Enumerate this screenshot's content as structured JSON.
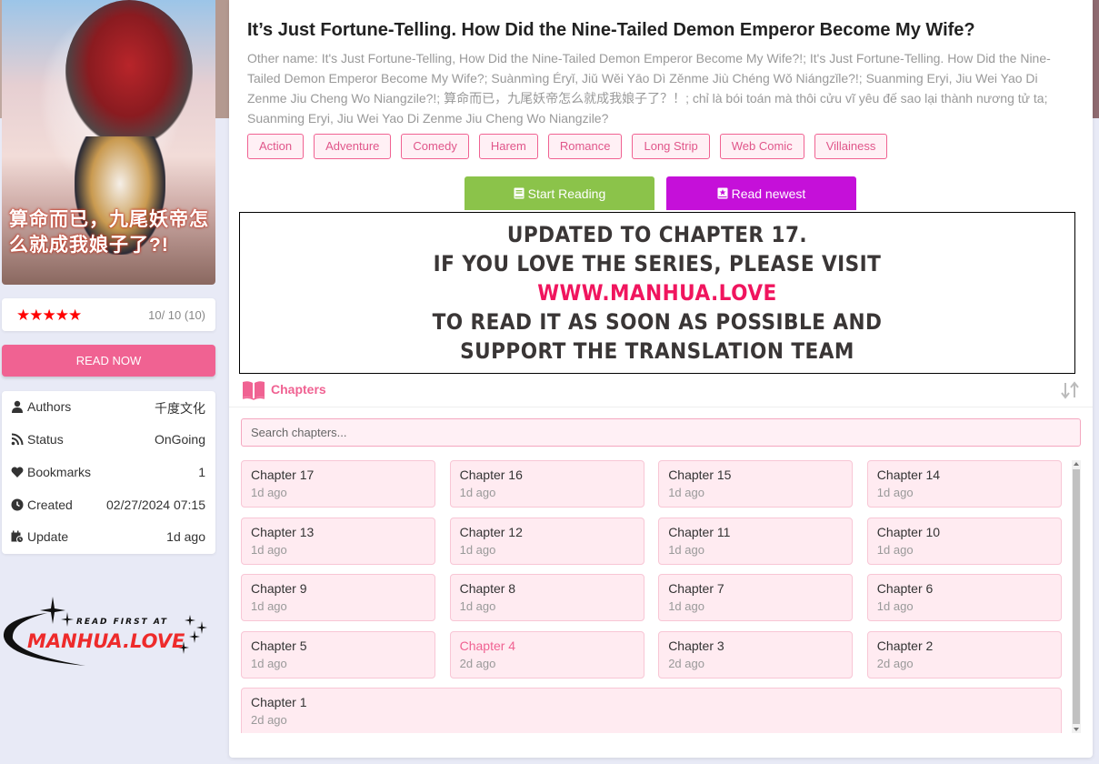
{
  "sidebar": {
    "cover_title": "算命而已，九尾妖帝怎么就成我娘子了?!",
    "rating": {
      "stars": 5,
      "max_stars": 5,
      "text": "10/ 10 (10)"
    },
    "read_now_label": "READ NOW",
    "info": [
      {
        "icon": "user-icon",
        "label": "Authors",
        "value": "千度文化"
      },
      {
        "icon": "rss-icon",
        "label": "Status",
        "value": "OnGoing"
      },
      {
        "icon": "heart-icon",
        "label": "Bookmarks",
        "value": "1"
      },
      {
        "icon": "clock-icon",
        "label": "Created",
        "value": "02/27/2024 07:15"
      },
      {
        "icon": "calendar-clock-icon",
        "label": "Update",
        "value": "1d ago"
      }
    ],
    "logo": {
      "top_text": "READ FIRST AT",
      "brand": "MANHUA.LOVE"
    }
  },
  "main": {
    "title": "It’s Just Fortune-Telling. How Did the Nine-Tailed Demon Emperor Become My Wife?",
    "other_name": "Other name: It's Just Fortune-Telling, How Did the Nine-Tailed Demon Emperor Become My Wife?!; It's Just Fortune-Telling. How Did the Nine-Tailed Demon Emperor Become My Wife?; Suànmìng Éryǐ, Jiǔ Wěi Yāo Dì Zěnme Jiù Chéng Wǒ Niángzǐle?!; Suanming Eryi, Jiu Wei Yao Di Zenme Jiu Cheng Wo Niangzile?!; 算命而已，九尾妖帝怎么就成我娘子了？！; chỉ là bói toán mà thôi cửu vĩ yêu đế sao lại thành nương tử ta; Suanming Eryi, Jiu Wei Yao Di Zenme Jiu Cheng Wo Niangzile?",
    "tags": [
      "Action",
      "Adventure",
      "Comedy",
      "Harem",
      "Romance",
      "Long Strip",
      "Web Comic",
      "Villainess"
    ],
    "start_reading_label": "Start Reading",
    "read_newest_label": "Read newest",
    "notice": {
      "lines": [
        "Updated to chapter 17.",
        "If you love the series, please visit",
        "www.manhua.love",
        "to read it as soon as possible and",
        "support the translation team"
      ],
      "highlight_index": 2,
      "highlight_color": "#f0155e"
    },
    "chapters_header": "Chapters",
    "search_placeholder": "Search chapters...",
    "chapters": [
      {
        "name": "Chapter 17",
        "time": "1d ago",
        "visited": false
      },
      {
        "name": "Chapter 16",
        "time": "1d ago",
        "visited": false
      },
      {
        "name": "Chapter 15",
        "time": "1d ago",
        "visited": false
      },
      {
        "name": "Chapter 14",
        "time": "1d ago",
        "visited": false
      },
      {
        "name": "Chapter 13",
        "time": "1d ago",
        "visited": false
      },
      {
        "name": "Chapter 12",
        "time": "1d ago",
        "visited": false
      },
      {
        "name": "Chapter 11",
        "time": "1d ago",
        "visited": false
      },
      {
        "name": "Chapter 10",
        "time": "1d ago",
        "visited": false
      },
      {
        "name": "Chapter 9",
        "time": "1d ago",
        "visited": false
      },
      {
        "name": "Chapter 8",
        "time": "1d ago",
        "visited": false
      },
      {
        "name": "Chapter 7",
        "time": "1d ago",
        "visited": false
      },
      {
        "name": "Chapter 6",
        "time": "1d ago",
        "visited": false
      },
      {
        "name": "Chapter 5",
        "time": "1d ago",
        "visited": false
      },
      {
        "name": "Chapter 4",
        "time": "2d ago",
        "visited": true
      },
      {
        "name": "Chapter 3",
        "time": "2d ago",
        "visited": false
      },
      {
        "name": "Chapter 2",
        "time": "2d ago",
        "visited": false
      },
      {
        "name": "Chapter 1",
        "time": "2d ago",
        "visited": false
      }
    ]
  },
  "colors": {
    "accent_pink": "#f06292",
    "start_green": "#8bc34a",
    "newest_purple": "#c510d9",
    "star_red": "#ff0000"
  }
}
